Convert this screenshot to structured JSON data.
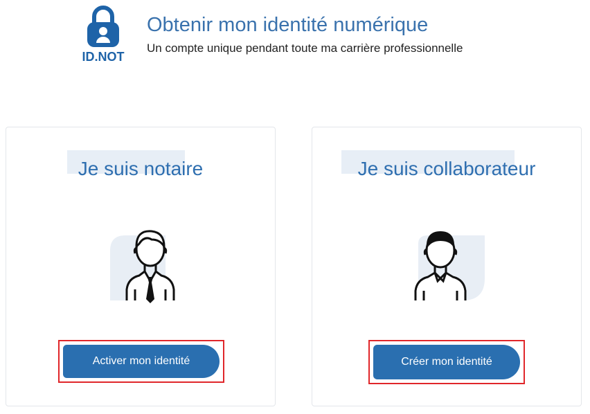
{
  "header": {
    "logo_text": "ID.NOT",
    "title": "Obtenir mon identité numérique",
    "subtitle": "Un compte unique pendant toute ma carrière professionnelle"
  },
  "cards": [
    {
      "title": "Je suis notaire",
      "button_label": "Activer mon identité"
    },
    {
      "title": "Je suis collaborateur",
      "button_label": "Créer mon identité"
    }
  ],
  "colors": {
    "brand": "#1e63a8",
    "button": "#2a6fb0",
    "highlight_border": "#e0262a",
    "title_bg": "#e7eef6"
  }
}
